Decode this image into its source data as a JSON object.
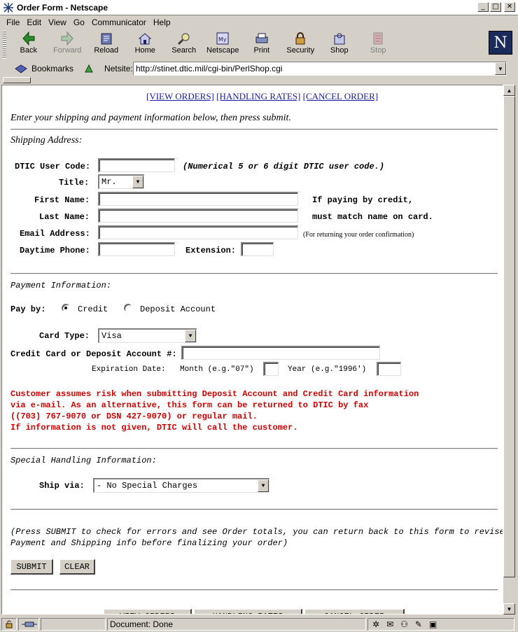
{
  "window": {
    "title": "Order Form - Netscape"
  },
  "menu": [
    "File",
    "Edit",
    "View",
    "Go",
    "Communicator",
    "Help"
  ],
  "toolbar": [
    {
      "label": "Back",
      "icon": "back-icon",
      "enabled": true
    },
    {
      "label": "Forward",
      "icon": "forward-icon",
      "enabled": false
    },
    {
      "label": "Reload",
      "icon": "reload-icon",
      "enabled": true
    },
    {
      "label": "Home",
      "icon": "home-icon",
      "enabled": true
    },
    {
      "label": "Search",
      "icon": "search-icon",
      "enabled": true
    },
    {
      "label": "Netscape",
      "icon": "netscape-icon",
      "enabled": true
    },
    {
      "label": "Print",
      "icon": "print-icon",
      "enabled": true
    },
    {
      "label": "Security",
      "icon": "lock-icon",
      "enabled": true
    },
    {
      "label": "Shop",
      "icon": "shop-icon",
      "enabled": true
    },
    {
      "label": "Stop",
      "icon": "stop-icon",
      "enabled": false
    }
  ],
  "location": {
    "bookmarks_label": "Bookmarks",
    "netsite_label": "Netsite:",
    "url": "http://stinet.dtic.mil/cgi-bin/PerlShop.cgi"
  },
  "page": {
    "top_links": [
      "[VIEW ORDERS]",
      "[HANDLING RATES]",
      "[CANCEL ORDER]"
    ],
    "intro": "Enter your shipping and payment information below, then press submit.",
    "shipping_heading": "Shipping Address:",
    "dtic_code_label": "DTIC User Code:",
    "dtic_code_note": "(Numerical 5 or 6 digit DTIC user code.)",
    "title_label": "Title:",
    "title_value": "Mr.",
    "first_name_label": "First Name:",
    "last_name_label": "Last Name:",
    "credit_note_1": "If paying by credit,",
    "credit_note_2": "must match name on card.",
    "email_label": "Email Address:",
    "email_note": "(For returning your order confirmation)",
    "phone_label": "Daytime Phone:",
    "extension_label": "Extension:",
    "payment_heading": "Payment Information:",
    "pay_by_label": "Pay by:",
    "pay_credit": "Credit",
    "pay_deposit": "Deposit Account",
    "card_type_label": "Card Type:",
    "card_type_value": "Visa",
    "card_number_label": "Credit Card or Deposit Account #:",
    "exp_label": "Expiration Date:",
    "month_label": "Month (e.g.\"07\")",
    "year_label": "Year (e.g.\"1996')",
    "warning": [
      "Customer assumes risk when submitting Deposit Account and Credit Card information",
      "via e-mail. As an alternative, this form can be returned to DTIC by fax",
      "((703) 767-9070 or DSN 427-9070) or regular mail.",
      "If information is not given, DTIC will call the customer."
    ],
    "special_heading": "Special Handling Information:",
    "ship_via_label": "Ship via:",
    "ship_via_value": "- No Special Charges",
    "submit_note_1": "(Press SUBMIT to check for errors and see Order totals, you can return back to this form to revise",
    "submit_note_2": "Payment and Shipping info before finalizing your order)",
    "submit_label": "SUBMIT",
    "clear_label": "CLEAR",
    "bottom_buttons": [
      "VIEW ORDERS",
      "HANDLING RATES",
      "CANCEL ORDER"
    ]
  },
  "status": {
    "text": "Document: Done"
  },
  "colors": {
    "link": "#1a1aa6",
    "warning": "#d40000",
    "chrome": "#d4d0c8"
  }
}
